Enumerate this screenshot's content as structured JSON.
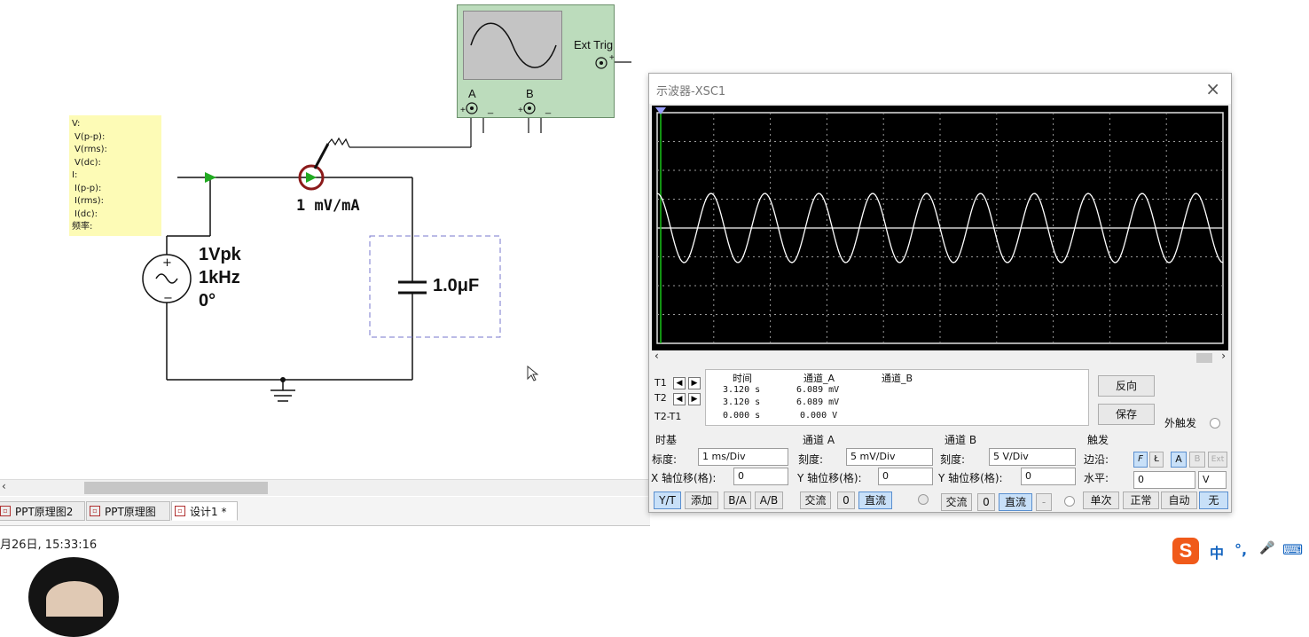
{
  "schematic": {
    "probe_fields": [
      "V:",
      "V(p-p):",
      "V(rms):",
      "V(dc):",
      "I:",
      "I(p-p):",
      "I(rms):",
      "I(dc):",
      "频率:"
    ],
    "current_probe_ratio": "1 mV/mA",
    "source": {
      "amplitude": "1Vpk",
      "frequency": "1kHz",
      "phase": "0°"
    },
    "capacitor": "1.0μF",
    "scope_icon": {
      "ext_trig": "Ext Trig",
      "channel_a": "A",
      "channel_b": "B",
      "plus": "+",
      "minus": "_"
    }
  },
  "tabs": [
    {
      "label": "PPT原理图2",
      "active": false
    },
    {
      "label": "PPT原理图",
      "active": false
    },
    {
      "label": "设计1 *",
      "active": true
    }
  ],
  "status": {
    "datetime": "月26日, 15:33:16"
  },
  "ime": {
    "logo": "S",
    "mode": "中",
    "punct": "°,",
    "mic": "🎤",
    "keyboard": "⌨"
  },
  "oscilloscope": {
    "title": "示波器-XSC1",
    "close": "×",
    "screen": {
      "waveform": "sine",
      "cycles": 10.5,
      "amplitude_div": 1.2,
      "trace_color": "#ffffff",
      "grid_color": "#9a9a9a"
    },
    "cursors": {
      "headers": [
        "时间",
        "通道_A",
        "通道_B"
      ],
      "rows": [
        {
          "label": "T1",
          "time": "3.120 s",
          "a": "6.089 mV",
          "b": ""
        },
        {
          "label": "T2",
          "time": "3.120 s",
          "a": "6.089 mV",
          "b": ""
        },
        {
          "label": "T2-T1",
          "time": "0.000 s",
          "a": "0.000 V",
          "b": ""
        }
      ]
    },
    "buttons": {
      "reverse": "反向",
      "save": "保存",
      "ext_trigger": "外触发"
    },
    "timebase": {
      "title": "时基",
      "scale_label": "标度:",
      "scale": "1 ms/Div",
      "xpos_label": "X 轴位移(格):",
      "xpos": "0",
      "modes": [
        "Y/T",
        "添加",
        "B/A",
        "A/B"
      ]
    },
    "channel_a": {
      "title": "通道 A",
      "scale_label": "刻度:",
      "scale": "5 mV/Div",
      "ypos_label": "Y 轴位移(格):",
      "ypos": "0",
      "coupling": [
        "交流",
        "0",
        "直流"
      ]
    },
    "channel_b": {
      "title": "通道 B",
      "scale_label": "刻度:",
      "scale": "5  V/Div",
      "ypos_label": "Y 轴位移(格):",
      "ypos": "0",
      "coupling": [
        "交流",
        "0",
        "直流",
        "-"
      ]
    },
    "trigger": {
      "title": "触发",
      "edge_label": "边沿:",
      "edges": [
        "F",
        "Ł",
        "A",
        "B",
        "Ext"
      ],
      "level_label": "水平:",
      "level": "0",
      "level_unit": "V",
      "modes": [
        "单次",
        "正常",
        "自动",
        "无"
      ]
    }
  }
}
